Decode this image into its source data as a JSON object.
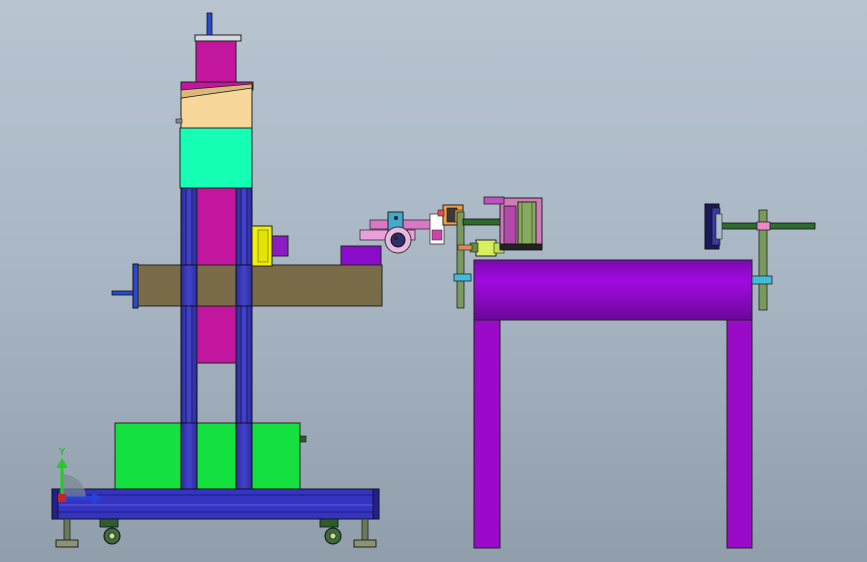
{
  "viewport": {
    "background_top": "#b8c4d0",
    "background_bottom": "#909eac"
  },
  "triad": {
    "y_label": "Y",
    "y_color": "#22cc22",
    "x_color": "#2244dd"
  },
  "colors": {
    "column_magenta": "#c2169e",
    "cap_beige": "#f8d89a",
    "block_mint": "#14ffb4",
    "rail_blue": "#3030b0",
    "arm_olive": "#7a6c48",
    "base_green": "#14e040",
    "table_purple": "#8c0ccc",
    "leg_purple": "#9a0ac8",
    "shaft_green": "#2f6a2f",
    "bracket_pink": "#ee88cc",
    "motor_yellow": "#f0f000",
    "clamp_cyan": "#44aacc"
  }
}
